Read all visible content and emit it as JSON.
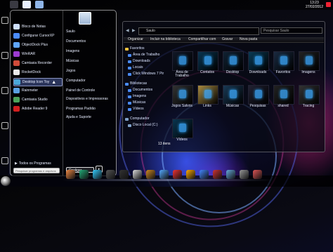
{
  "clock": {
    "time": "13:23",
    "date": "27/02/2012"
  },
  "start_menu": {
    "programs": [
      {
        "label": "Bloco de Notas",
        "color": "#cfe0ff"
      },
      {
        "label": "Configurar CursorXP",
        "color": "#4a8cff"
      },
      {
        "label": "ObjectDock Plus",
        "color": "#5fa6ff"
      },
      {
        "label": "WinRAR",
        "color": "#9c3bd1"
      },
      {
        "label": "Camtasia Recorder",
        "color": "#d04b3a"
      },
      {
        "label": "RocketDock",
        "color": "#e9e9e9"
      },
      {
        "label": "Desktop Icon Toy",
        "color": "#4aa8d8"
      },
      {
        "label": "Rainmeter",
        "color": "#5aa0e0"
      },
      {
        "label": "Camtasia Studio",
        "color": "#4ca35a"
      },
      {
        "label": "Adobe Reader 9",
        "color": "#d21f1f"
      }
    ],
    "all_programs": "Todos os Programas",
    "search_placeholder": "Pesquisar programas e arquivos",
    "right_items": [
      "Saulo",
      "Documentos",
      "Imagens",
      "Músicas",
      "Jogos",
      "Computador",
      "Painel de Controle",
      "Dispositivos e Impressoras",
      "Programas Padrão",
      "Ajuda e Suporte"
    ],
    "shutdown": "Desligar"
  },
  "explorer": {
    "address": "Saulo",
    "search_placeholder": "Pesquisar Saulo",
    "toolbar": [
      "Organizar",
      "Incluir na biblioteca",
      "Compartilhar com",
      "Gravar",
      "Nova pasta"
    ],
    "nav": [
      {
        "label": "Favoritos",
        "type": "header",
        "color": "#f3c340"
      },
      {
        "label": "Área de Trabalho",
        "color": "#4a8cff"
      },
      {
        "label": "Downloads",
        "color": "#4a8cff"
      },
      {
        "label": "Locais",
        "color": "#4a8cff"
      },
      {
        "label": "Click Windows 7 Pir",
        "color": "#4a8cff"
      },
      {
        "label": "Bibliotecas",
        "type": "header",
        "color": "#4a8cff"
      },
      {
        "label": "Documentos",
        "color": "#4a8cff"
      },
      {
        "label": "Imagens",
        "color": "#4a8cff"
      },
      {
        "label": "Músicas",
        "color": "#4a8cff"
      },
      {
        "label": "Vídeos",
        "color": "#4a8cff"
      },
      {
        "label": "Computador",
        "type": "header",
        "color": "#7fa0c8"
      },
      {
        "label": "Disco Local (C:)",
        "color": "#7fa0c8"
      }
    ],
    "items": [
      "Área de Trabalho",
      "Contatos",
      "Desktop",
      "Downloads",
      "Favoritos",
      "Imagens",
      "Jogos Salvos",
      "Links",
      "Músicas",
      "Pesquisas",
      "shared",
      "Tracing",
      "Vídeos"
    ],
    "status": "13 itens"
  },
  "colors": {
    "accent": "#3d6bff",
    "dock": [
      "#e84",
      "#2a7",
      "#3cf",
      "#555",
      "#333",
      "#ddd",
      "#c82",
      "#5af",
      "#e33",
      "#fa0",
      "#48f",
      "#c33",
      "#6ad",
      "#999",
      "#d55"
    ]
  }
}
